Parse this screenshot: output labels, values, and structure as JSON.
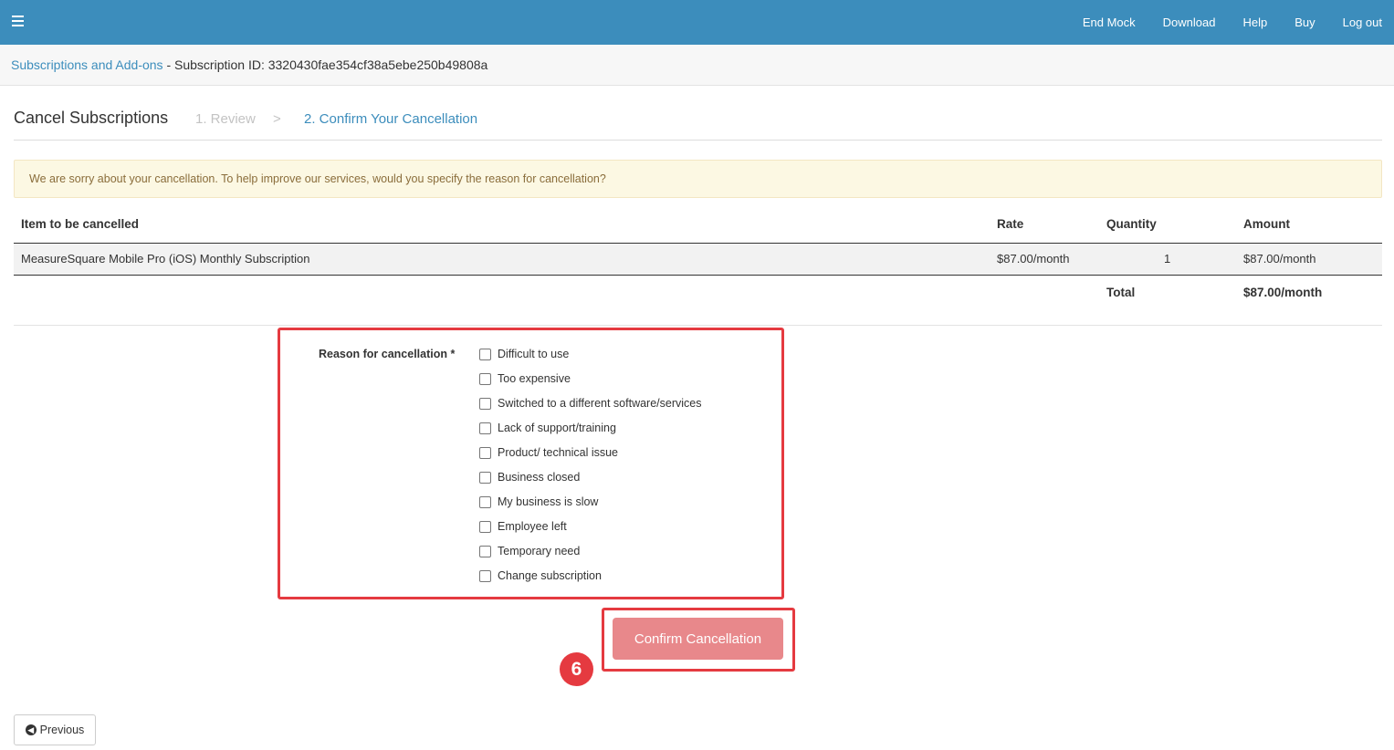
{
  "topbar": {
    "menu_icon": "hamburger-menu-icon",
    "nav": [
      "End Mock",
      "Download",
      "Help",
      "Buy",
      "Log out"
    ]
  },
  "breadcrumb": {
    "link": "Subscriptions and Add-ons",
    "separator": " - ",
    "current": "Subscription ID: 3320430fae354cf38a5ebe250b49808a"
  },
  "header": {
    "title": "Cancel Subscriptions",
    "step1": "1. Review",
    "step_separator": ">",
    "step2": "2. Confirm Your Cancellation"
  },
  "alert": {
    "text": "We are sorry about your cancellation. To help improve our services, would you specify the reason for cancellation?"
  },
  "table": {
    "headers": [
      "Item to be cancelled",
      "Rate",
      "Quantity",
      "Amount"
    ],
    "rows": [
      [
        "MeasureSquare Mobile Pro (iOS) Monthly Subscription",
        "$87.00/month",
        "1",
        "$87.00/month"
      ]
    ],
    "total_label": "Total",
    "total_value": "$87.00/month"
  },
  "reasons": {
    "label": "Reason for cancellation *",
    "options": [
      "Difficult to use",
      "Too expensive",
      "Switched to a different software/services",
      "Lack of support/training",
      "Product/ technical issue",
      "Business closed",
      "My business is slow",
      "Employee left",
      "Temporary need",
      "Change subscription"
    ]
  },
  "confirm_button": "Confirm Cancellation",
  "step_badge": "6",
  "previous_button": {
    "icon": "circle-arrow-left-icon",
    "label": "Previous"
  },
  "colors": {
    "topbar": "#3c8dbc",
    "link": "#3c8dbc",
    "alert_bg": "#fcf8e3",
    "annotation": "#e53a40",
    "confirm_button": "#e8888b"
  }
}
